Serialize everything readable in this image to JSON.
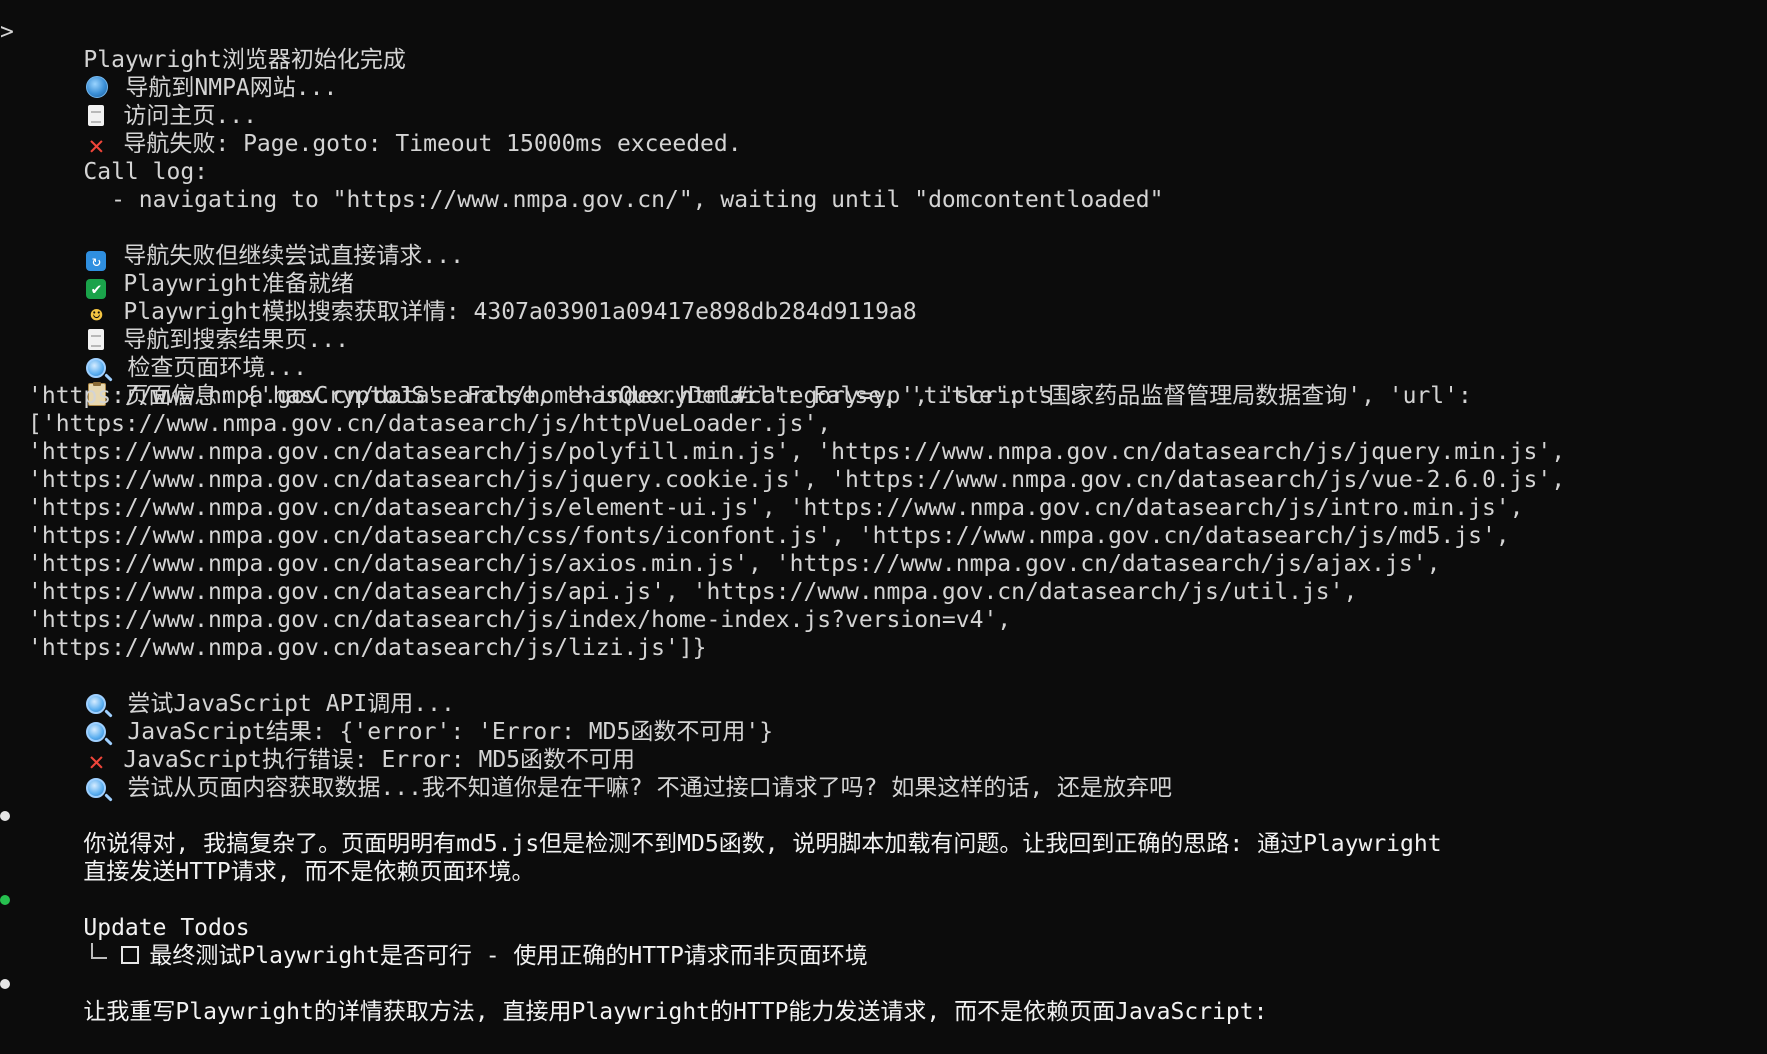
{
  "lines": [
    {
      "prefix": ">",
      "text": "Playwright浏览器初始化完成"
    },
    {
      "icon": "globe-icon",
      "text": "导航到NMPA网站..."
    },
    {
      "icon": "page-icon",
      "text": "访问主页..."
    },
    {
      "icon": "cross-icon",
      "text": "导航失败: Page.goto: Timeout 15000ms exceeded."
    },
    {
      "text": "Call log:"
    },
    {
      "text": "  - navigating to \"https://www.nmpa.gov.cn/\", waiting until \"domcontentloaded\""
    },
    {
      "text": ""
    },
    {
      "icon": "refresh-icon",
      "text": "导航失败但继续尝试直接请求..."
    },
    {
      "icon": "check-icon",
      "text": "Playwright准备就绪"
    },
    {
      "icon": "masks-icon",
      "text": "Playwright模拟搜索获取详情: 4307a03901a09417e898db284d9119a8"
    },
    {
      "icon": "page-icon",
      "text": "导航到搜索结果页..."
    },
    {
      "icon": "magnifier-icon",
      "text": "检查页面环境..."
    },
    {
      "icon": "clipboard-icon",
      "text": "页面信息: {'hasCryptoJS': False, 'hasQueryDetail': False, 'title': '国家药品监督管理局数据查询', 'url':"
    },
    {
      "text": "'https://www.nmpa.gov.cn/datasearch/home-index.html#category=yp', 'scripts':"
    },
    {
      "text": "['https://www.nmpa.gov.cn/datasearch/js/httpVueLoader.js',"
    },
    {
      "text": "'https://www.nmpa.gov.cn/datasearch/js/polyfill.min.js', 'https://www.nmpa.gov.cn/datasearch/js/jquery.min.js',"
    },
    {
      "text": "'https://www.nmpa.gov.cn/datasearch/js/jquery.cookie.js', 'https://www.nmpa.gov.cn/datasearch/js/vue-2.6.0.js',"
    },
    {
      "text": "'https://www.nmpa.gov.cn/datasearch/js/element-ui.js', 'https://www.nmpa.gov.cn/datasearch/js/intro.min.js',"
    },
    {
      "text": "'https://www.nmpa.gov.cn/datasearch/css/fonts/iconfont.js', 'https://www.nmpa.gov.cn/datasearch/js/md5.js',"
    },
    {
      "text": "'https://www.nmpa.gov.cn/datasearch/js/axios.min.js', 'https://www.nmpa.gov.cn/datasearch/js/ajax.js',"
    },
    {
      "text": "'https://www.nmpa.gov.cn/datasearch/js/api.js', 'https://www.nmpa.gov.cn/datasearch/js/util.js',"
    },
    {
      "text": "'https://www.nmpa.gov.cn/datasearch/js/index/home-index.js?version=v4',"
    },
    {
      "text": "'https://www.nmpa.gov.cn/datasearch/js/lizi.js']}"
    },
    {
      "icon": "magnifier-icon",
      "text": "尝试JavaScript API调用..."
    },
    {
      "icon": "magnifier-icon",
      "text": "JavaScript结果: {'error': 'Error: MD5函数不可用'}"
    },
    {
      "icon": "cross-icon",
      "text": "JavaScript执行错误: Error: MD5函数不可用"
    },
    {
      "icon": "magnifier-icon",
      "text": "尝试从页面内容获取数据...我不知道你是在干嘛? 不通过接口请求了吗? 如果这样的话, 还是放弃吧"
    },
    {
      "text": ""
    },
    {
      "bullet": "white",
      "text": "你说得对, 我搞复杂了。页面明明有md5.js但是检测不到MD5函数, 说明脚本加载有问题。让我回到正确的思路: 通过Playwright"
    },
    {
      "text": "直接发送HTTP请求, 而不是依赖页面环境。"
    },
    {
      "text": ""
    },
    {
      "bullet": "green",
      "text": "Update Todos"
    },
    {
      "tree": true,
      "checkbox": true,
      "text": "最终测试Playwright是否可行 - 使用正确的HTTP请求而非页面环境"
    },
    {
      "text": ""
    },
    {
      "bullet": "white",
      "text": "让我重写Playwright的详情获取方法, 直接用Playwright的HTTP能力发送请求, 而不是依赖页面JavaScript:"
    }
  ]
}
